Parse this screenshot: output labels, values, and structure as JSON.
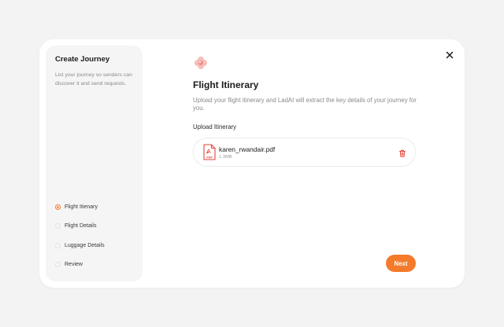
{
  "sidebar": {
    "title": "Create Journey",
    "description": "List your journey so senders can discover it and send requests.",
    "steps": [
      {
        "label": "Flight Itienary",
        "active": true
      },
      {
        "label": "Flight Details",
        "active": false
      },
      {
        "label": "Luggage Details",
        "active": false
      },
      {
        "label": "Review",
        "active": false
      }
    ]
  },
  "main": {
    "title": "Flight Itinerary",
    "description": "Upload your flight itinerary and LadAI will extract the key details of your journey for you.",
    "upload_label": "Upload Itinerary",
    "file": {
      "name": "karen_rwandair.pdf",
      "size": "1.3MB",
      "icon": "pdf-icon",
      "badge": "PDF"
    },
    "next_label": "Next"
  },
  "colors": {
    "accent": "#f47b2b",
    "trash": "#e2463a",
    "background": "#f3f3f3",
    "sidebar": "#f5f5f5"
  }
}
